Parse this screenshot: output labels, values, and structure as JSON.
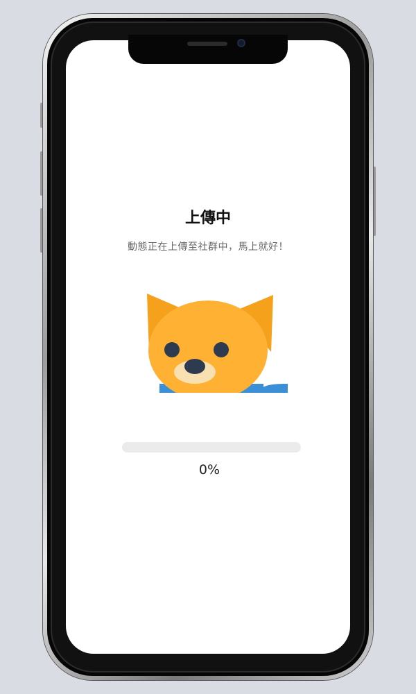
{
  "upload": {
    "title": "上傳中",
    "message": "動態正在上傳至社群中，馬上就好！",
    "progress_value": 0,
    "progress_label": "0%"
  },
  "illustration": {
    "icon": "shiba-dog-icon"
  },
  "colors": {
    "background": "#ffffff",
    "dog_orange": "#ffb133",
    "dog_ear": "#f5a11c",
    "muzzle": "#f9e0b0",
    "eyes": "#2e3a4f",
    "collar_blue": "#3a8fd6",
    "progress_track": "#ebebeb"
  }
}
